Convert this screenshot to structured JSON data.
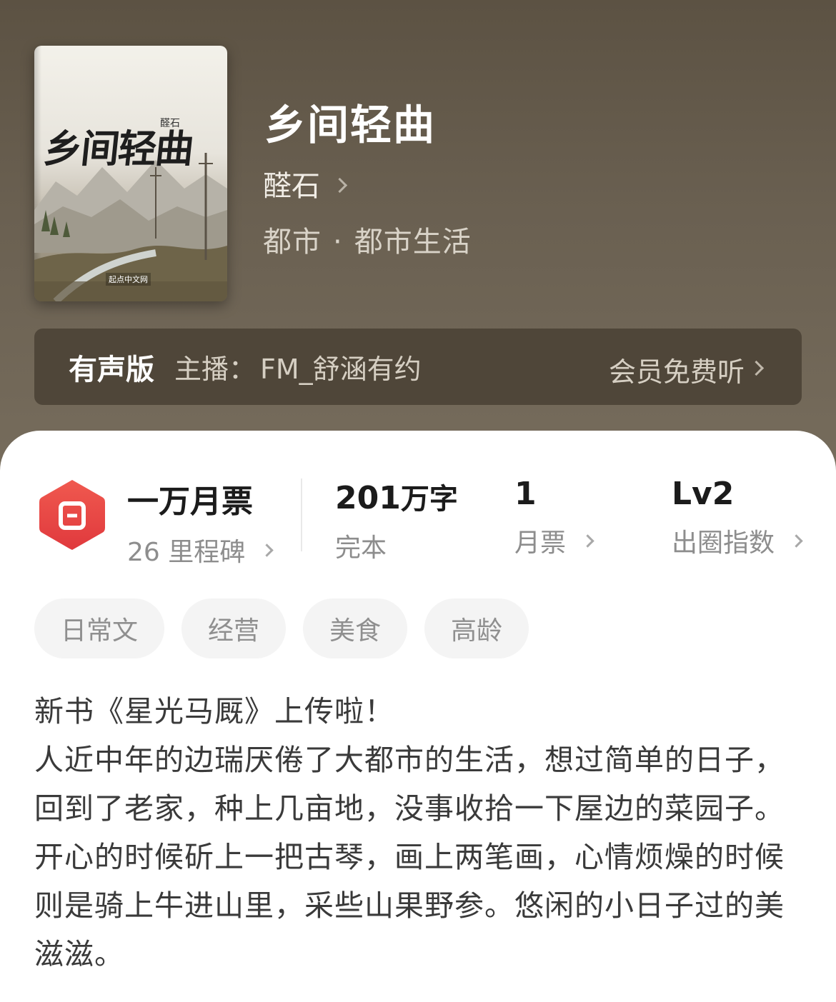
{
  "book": {
    "title": "乡间轻曲",
    "author": "醛石",
    "genre": "都市",
    "subgenre": "都市生活",
    "cover": {
      "title": "乡间轻曲",
      "author": "醛石",
      "publisher": "起点中文网"
    }
  },
  "audio": {
    "tag": "有声版",
    "host_label": "主播：",
    "host_name": "FM_舒涵有约",
    "action": "会员免费听"
  },
  "stats": {
    "monthly_title": "一万月票",
    "milestones": "26 里程碑",
    "words_number": "201",
    "words_unit": "万字",
    "status": "完本",
    "ticket_count": "1",
    "ticket_label": "月票",
    "level": "Lv2",
    "level_label": "出圈指数"
  },
  "tags": [
    "日常文",
    "经营",
    "美食",
    "高龄"
  ],
  "description": [
    "新书《星光马厩》上传啦！",
    "人近中年的边瑞厌倦了大都市的生活，想过简单的日子，回到了老家，种上几亩地，没事收拾一下屋边的菜园子。开心的时候斫上一把古琴，画上两笔画，心情烦燥的时候则是骑上牛进山里，采些山果野参。悠闲的小日子过的美滋滋。"
  ],
  "colors": {
    "hero_bg": "#5f5646",
    "badge_red": "#e84a4a",
    "text_dark": "#1b1b1b",
    "text_muted": "#8d8d8d"
  },
  "icons": {
    "badge": "ticket-hexagon-icon",
    "chevron": "chevron-right-icon"
  }
}
